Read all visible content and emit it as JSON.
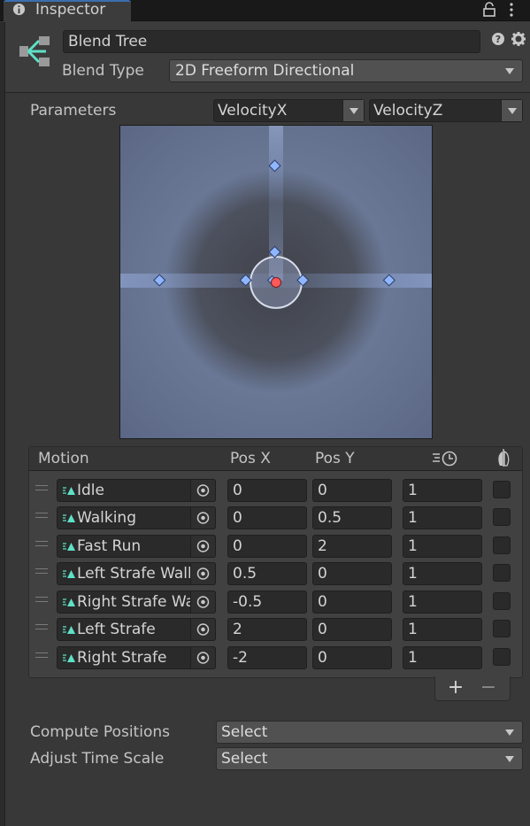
{
  "tab": {
    "title": "Inspector"
  },
  "header": {
    "name": "Blend Tree",
    "blend_type_label": "Blend Type",
    "blend_type_value": "2D Freeform Directional"
  },
  "parameters": {
    "label": "Parameters",
    "x": "VelocityX",
    "y": "VelocityZ"
  },
  "motion_list": {
    "headers": {
      "motion": "Motion",
      "pos_x": "Pos X",
      "pos_y": "Pos Y"
    },
    "rows": [
      {
        "name": "Idle",
        "pos_x": "0",
        "pos_y": "0",
        "speed": "1"
      },
      {
        "name": "Walking",
        "pos_x": "0",
        "pos_y": "0.5",
        "speed": "1"
      },
      {
        "name": "Fast Run",
        "pos_x": "0",
        "pos_y": "2",
        "speed": "1"
      },
      {
        "name": "Left Strafe Walk",
        "pos_x": "0.5",
        "pos_y": "0",
        "speed": "1"
      },
      {
        "name": "Right Strafe Walk",
        "pos_x": "-0.5",
        "pos_y": "0",
        "speed": "1"
      },
      {
        "name": "Left Strafe",
        "pos_x": "2",
        "pos_y": "0",
        "speed": "1"
      },
      {
        "name": "Right Strafe",
        "pos_x": "-2",
        "pos_y": "0",
        "speed": "1"
      }
    ],
    "add": "+",
    "remove": "−"
  },
  "compute_positions": {
    "label": "Compute Positions",
    "value": "Select"
  },
  "adjust_time_scale": {
    "label": "Adjust Time Scale",
    "value": "Select"
  },
  "colors": {
    "accent": "#3a6fb0",
    "node": "#8fb6ff",
    "current": "#ff5a5a"
  },
  "icons": [
    "info-icon",
    "lock-icon",
    "more-icon",
    "blend-tree-icon",
    "help-icon",
    "settings-icon",
    "animation-clip-icon",
    "object-picker-icon",
    "time-scale-icon",
    "mirror-icon"
  ]
}
